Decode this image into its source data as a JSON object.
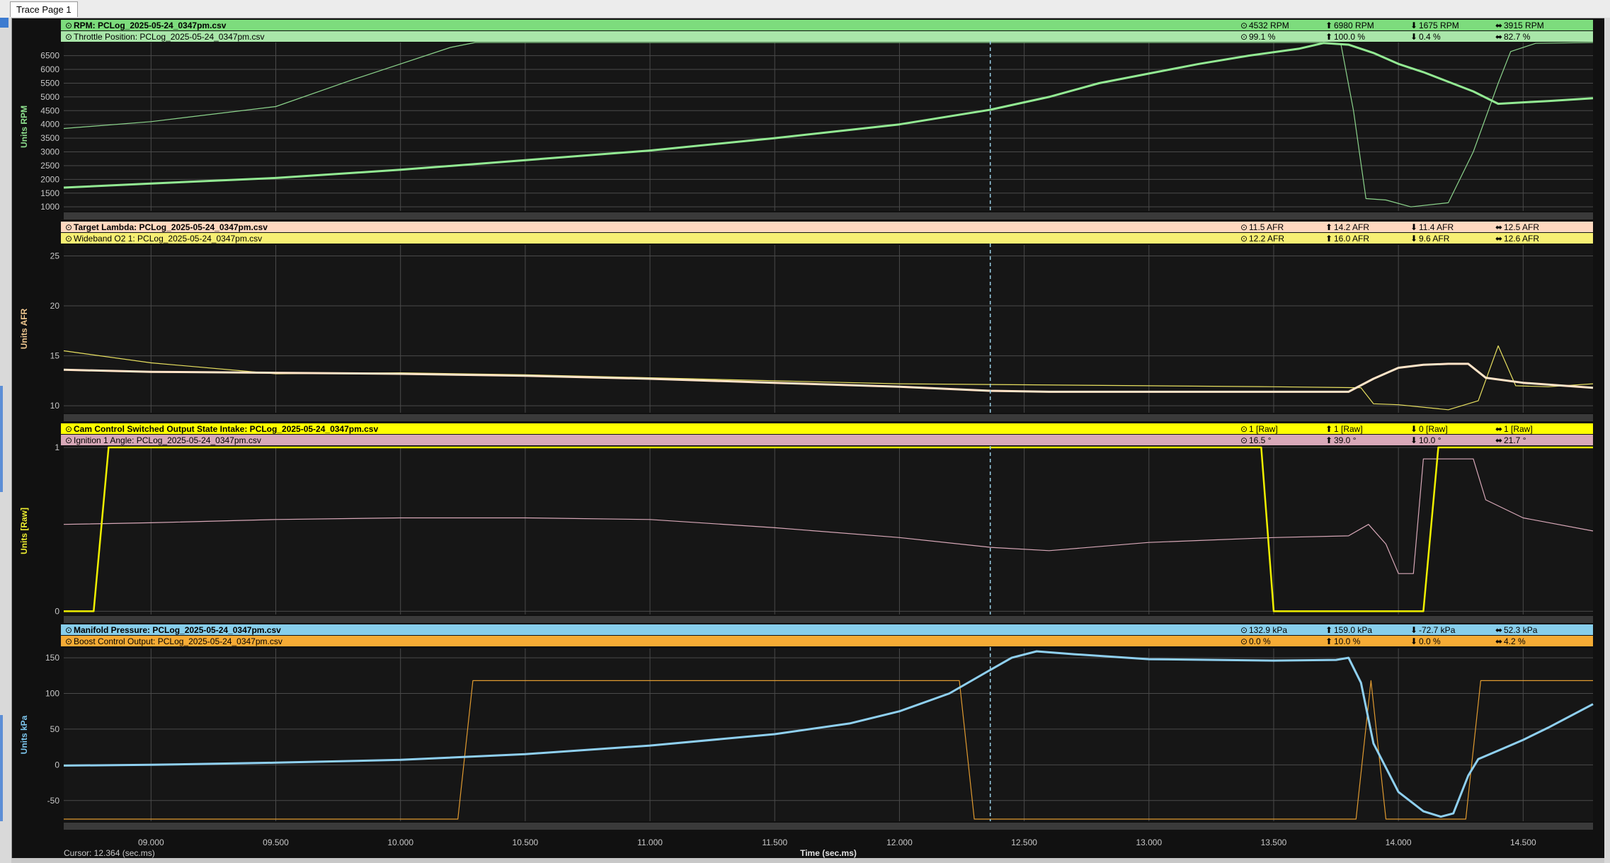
{
  "window": {
    "tab_label": "Trace Page 1"
  },
  "footer": {
    "cursor_label": "Cursor: 12.364 (sec.ms)"
  },
  "chart_data": {
    "type": "line",
    "xlabel": "Time (sec.ms)",
    "xlim": [
      8.65,
      14.78
    ],
    "x_ticks": [
      "09.000",
      "09.500",
      "10.000",
      "10.500",
      "11.000",
      "11.500",
      "12.000",
      "12.500",
      "13.000",
      "13.500",
      "14.000",
      "14.500"
    ],
    "x_tick_values": [
      9.0,
      9.5,
      10.0,
      10.5,
      11.0,
      11.5,
      12.0,
      12.5,
      13.0,
      13.5,
      14.0,
      14.5
    ],
    "cursor_x": 12.364,
    "panels": [
      {
        "ylabel": "Units RPM",
        "label_color": "#8ee08e",
        "ylim": [
          850,
          6980
        ],
        "y_ticks": [
          1000,
          1500,
          2000,
          2500,
          3000,
          3500,
          4000,
          4500,
          5000,
          5500,
          6000,
          6500
        ],
        "series": [
          {
            "name": "RPM: PCLog_2025-05-24_0347pm.csv",
            "header_bg": "#7ddc7d",
            "bold": true,
            "stats": [
              "4532 RPM",
              "6980 RPM",
              "1675 RPM",
              "3915 RPM"
            ],
            "color": "#93ea93",
            "width": 3,
            "x": [
              8.65,
              9.0,
              9.5,
              10.0,
              10.5,
              11.0,
              11.5,
              12.0,
              12.364,
              12.6,
              12.8,
              13.0,
              13.2,
              13.4,
              13.6,
              13.7,
              13.8,
              13.9,
              14.0,
              14.1,
              14.2,
              14.3,
              14.4,
              14.5,
              14.6,
              14.78
            ],
            "y": [
              1700,
              1850,
              2050,
              2350,
              2700,
              3050,
              3500,
              4000,
              4532,
              5000,
              5500,
              5850,
              6200,
              6500,
              6750,
              6960,
              6900,
              6600,
              6200,
              5900,
              5550,
              5200,
              4750,
              4800,
              4850,
              4950
            ]
          },
          {
            "name": "Throttle Position: PCLog_2025-05-24_0347pm.csv",
            "header_bg": "#a9e6a9",
            "bold": false,
            "stats": [
              "99.1 %",
              "100.0 %",
              "0.4 %",
              "82.7 %"
            ],
            "color": "#8cd48c",
            "width": 1.2,
            "x": [
              8.65,
              9.0,
              9.5,
              9.8,
              10.0,
              10.2,
              10.3,
              10.5,
              11.0,
              12.0,
              13.0,
              13.7,
              13.77,
              13.82,
              13.87,
              13.95,
              14.05,
              14.2,
              14.3,
              14.4,
              14.45,
              14.55,
              14.78
            ],
            "y": [
              3850,
              4100,
              4650,
              5600,
              6200,
              6800,
              6980,
              6980,
              6980,
              6980,
              6980,
              6980,
              6900,
              4500,
              1300,
              1250,
              1000,
              1150,
              3000,
              5500,
              6650,
              6950,
              6980
            ]
          }
        ]
      },
      {
        "ylabel": "Units AFR",
        "label_color": "#f0c890",
        "ylim": [
          9.3,
          26.1
        ],
        "y_ticks": [
          10,
          15,
          20,
          25
        ],
        "series": [
          {
            "name": "Target Lambda: PCLog_2025-05-24_0347pm.csv",
            "header_bg": "#ffd8bf",
            "bold": true,
            "stats": [
              "11.5 AFR",
              "14.2 AFR",
              "11.4 AFR",
              "12.5 AFR"
            ],
            "color": "#ffe4c8",
            "width": 3,
            "x": [
              8.65,
              9.0,
              9.5,
              10.0,
              10.5,
              11.0,
              11.5,
              12.0,
              12.364,
              12.6,
              13.0,
              13.5,
              13.8,
              13.9,
              14.0,
              14.1,
              14.2,
              14.28,
              14.35,
              14.5,
              14.78
            ],
            "y": [
              13.6,
              13.4,
              13.3,
              13.2,
              13.0,
              12.7,
              12.3,
              11.9,
              11.5,
              11.4,
              11.4,
              11.4,
              11.4,
              12.7,
              13.8,
              14.1,
              14.2,
              14.2,
              12.8,
              12.3,
              11.8
            ]
          },
          {
            "name": "Wideband O2 1: PCLog_2025-05-24_0347pm.csv",
            "header_bg": "#f7ef73",
            "bold": false,
            "stats": [
              "12.2 AFR",
              "16.0 AFR",
              "9.6 AFR",
              "12.6 AFR"
            ],
            "color": "#e8e060",
            "width": 1.2,
            "x": [
              8.65,
              9.0,
              9.5,
              10.0,
              10.5,
              11.0,
              11.5,
              12.0,
              12.5,
              13.0,
              13.5,
              13.85,
              13.9,
              14.0,
              14.2,
              14.32,
              14.4,
              14.47,
              14.6,
              14.78
            ],
            "y": [
              15.5,
              14.3,
              13.2,
              13.3,
              13.1,
              12.8,
              12.5,
              12.2,
              12.1,
              12.0,
              11.9,
              11.8,
              10.2,
              10.1,
              9.6,
              10.5,
              16.0,
              12.0,
              11.9,
              12.2
            ]
          }
        ]
      },
      {
        "ylabel": "Units [Raw]",
        "label_color": "#f0f030",
        "ylim": [
          -0.02,
          1.0
        ],
        "y_ticks": [
          0,
          1
        ],
        "series": [
          {
            "name": "Cam Control Switched Output State Intake: PCLog_2025-05-24_0347pm.csv",
            "header_bg": "#ffff00",
            "bold": true,
            "stats": [
              "1 [Raw]",
              "1 [Raw]",
              "0 [Raw]",
              "1 [Raw]"
            ],
            "color": "#f0f000",
            "width": 2.5,
            "x": [
              8.65,
              8.77,
              8.83,
              13.45,
              13.5,
              14.1,
              14.16,
              14.78
            ],
            "y": [
              0,
              0,
              1,
              1,
              0,
              0,
              1,
              1
            ]
          },
          {
            "name": "Ignition 1 Angle: PCLog_2025-05-24_0347pm.csv",
            "header_bg": "#d8a8b8",
            "bold": false,
            "stats": [
              "16.5 °",
              "39.0 °",
              "10.0 °",
              "21.7 °"
            ],
            "color": "#d8a8b8",
            "width": 1.2,
            "x": [
              8.65,
              9.0,
              9.5,
              10.0,
              10.5,
              11.0,
              11.5,
              12.0,
              12.364,
              12.6,
              13.0,
              13.5,
              13.8,
              13.88,
              13.95,
              14.0,
              14.06,
              14.1,
              14.3,
              14.35,
              14.5,
              14.78
            ],
            "y": [
              0.53,
              0.54,
              0.56,
              0.57,
              0.57,
              0.56,
              0.51,
              0.45,
              0.39,
              0.37,
              0.42,
              0.45,
              0.46,
              0.53,
              0.41,
              0.23,
              0.23,
              0.93,
              0.93,
              0.68,
              0.57,
              0.49
            ]
          }
        ]
      },
      {
        "ylabel": "Units kPa",
        "label_color": "#7ec8f0",
        "ylim": [
          -79,
          163
        ],
        "y_ticks": [
          -50,
          0,
          50,
          100,
          150
        ],
        "series": [
          {
            "name": "Manifold Pressure: PCLog_2025-05-24_0347pm.csv",
            "header_bg": "#87ceeb",
            "bold": true,
            "stats": [
              "132.9 kPa",
              "159.0 kPa",
              "-72.7 kPa",
              "52.3 kPa"
            ],
            "color": "#8fd0f0",
            "width": 3,
            "x": [
              8.65,
              9.0,
              9.5,
              10.0,
              10.5,
              11.0,
              11.5,
              11.8,
              12.0,
              12.2,
              12.364,
              12.45,
              12.55,
              12.7,
              13.0,
              13.5,
              13.75,
              13.8,
              13.85,
              13.9,
              14.0,
              14.1,
              14.17,
              14.22,
              14.28,
              14.32,
              14.4,
              14.5,
              14.6,
              14.78
            ],
            "y": [
              -1,
              0,
              3,
              7,
              15,
              27,
              43,
              58,
              75,
              100,
              132.9,
              150,
              159,
              155,
              148,
              146,
              147,
              150,
              115,
              30,
              -38,
              -65,
              -72.7,
              -68,
              -15,
              8,
              20,
              35,
              52,
              85
            ]
          },
          {
            "name": "Boost Control Output: PCLog_2025-05-24_0347pm.csv",
            "header_bg": "#f5ab35",
            "bold": false,
            "stats": [
              "0.0 %",
              "10.0 %",
              "0.0 %",
              "4.2 %"
            ],
            "color": "#e09a30",
            "width": 1.2,
            "x": [
              8.65,
              10.23,
              10.29,
              12.24,
              12.3,
              13.83,
              13.89,
              13.95,
              14.0,
              14.27,
              14.33,
              14.78
            ],
            "y": [
              -76,
              -76,
              118,
              118,
              -76,
              -76,
              118,
              -76,
              -76,
              -76,
              118,
              118
            ]
          }
        ]
      }
    ]
  }
}
